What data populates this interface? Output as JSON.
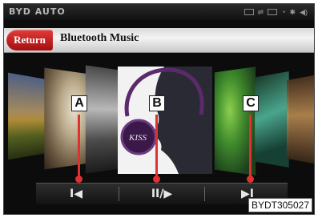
{
  "status_bar": {
    "brand": "BYD AUTO",
    "icons": [
      "phone-icon",
      "usb-icon",
      "radio-icon",
      "bluetooth-icon",
      "volume-icon"
    ]
  },
  "header": {
    "return_label": "Return",
    "title": "Bluetooth Music"
  },
  "album": {
    "art_text": "KISS"
  },
  "controls": {
    "prev_label": "I◀",
    "play_pause_label": "II/▶",
    "next_label": "▶I"
  },
  "callouts": {
    "a": "A",
    "b": "B",
    "c": "C"
  },
  "reference_code": "BYDT305027",
  "colors": {
    "accent": "#e03030",
    "return_button": "#c01a1a"
  }
}
